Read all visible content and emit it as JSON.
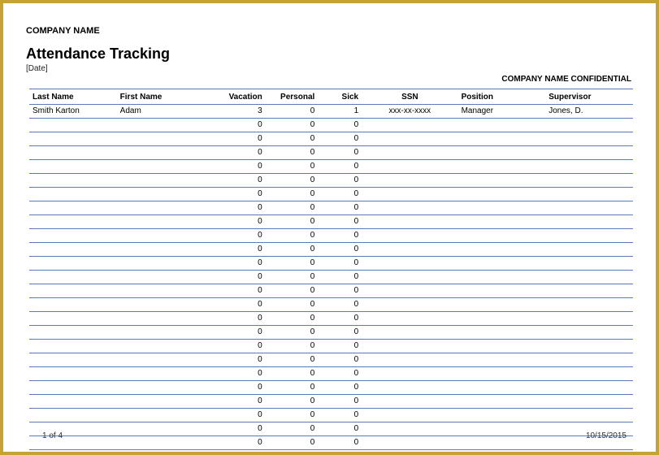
{
  "header": {
    "company_name": "COMPANY NAME",
    "title": "Attendance Tracking",
    "date_label": "[Date]",
    "confidential": "COMPANY NAME CONFIDENTIAL"
  },
  "columns": {
    "last_name": "Last Name",
    "first_name": "First Name",
    "vacation": "Vacation",
    "personal": "Personal",
    "sick": "Sick",
    "ssn": "SSN",
    "position": "Position",
    "supervisor": "Supervisor"
  },
  "rows": [
    {
      "last_name": "Smith Karton",
      "first_name": "Adam",
      "vacation": "3",
      "personal": "0",
      "sick": "1",
      "ssn": "xxx-xx-xxxx",
      "position": "Manager",
      "supervisor": "Jones, D."
    },
    {
      "last_name": "",
      "first_name": "",
      "vacation": "0",
      "personal": "0",
      "sick": "0",
      "ssn": "",
      "position": "",
      "supervisor": ""
    },
    {
      "last_name": "",
      "first_name": "",
      "vacation": "0",
      "personal": "0",
      "sick": "0",
      "ssn": "",
      "position": "",
      "supervisor": ""
    },
    {
      "last_name": "",
      "first_name": "",
      "vacation": "0",
      "personal": "0",
      "sick": "0",
      "ssn": "",
      "position": "",
      "supervisor": ""
    },
    {
      "last_name": "",
      "first_name": "",
      "vacation": "0",
      "personal": "0",
      "sick": "0",
      "ssn": "",
      "position": "",
      "supervisor": ""
    },
    {
      "last_name": "",
      "first_name": "",
      "vacation": "0",
      "personal": "0",
      "sick": "0",
      "ssn": "",
      "position": "",
      "supervisor": ""
    },
    {
      "last_name": "",
      "first_name": "",
      "vacation": "0",
      "personal": "0",
      "sick": "0",
      "ssn": "",
      "position": "",
      "supervisor": ""
    },
    {
      "last_name": "",
      "first_name": "",
      "vacation": "0",
      "personal": "0",
      "sick": "0",
      "ssn": "",
      "position": "",
      "supervisor": ""
    },
    {
      "last_name": "",
      "first_name": "",
      "vacation": "0",
      "personal": "0",
      "sick": "0",
      "ssn": "",
      "position": "",
      "supervisor": ""
    },
    {
      "last_name": "",
      "first_name": "",
      "vacation": "0",
      "personal": "0",
      "sick": "0",
      "ssn": "",
      "position": "",
      "supervisor": ""
    },
    {
      "last_name": "",
      "first_name": "",
      "vacation": "0",
      "personal": "0",
      "sick": "0",
      "ssn": "",
      "position": "",
      "supervisor": ""
    },
    {
      "last_name": "",
      "first_name": "",
      "vacation": "0",
      "personal": "0",
      "sick": "0",
      "ssn": "",
      "position": "",
      "supervisor": ""
    },
    {
      "last_name": "",
      "first_name": "",
      "vacation": "0",
      "personal": "0",
      "sick": "0",
      "ssn": "",
      "position": "",
      "supervisor": ""
    },
    {
      "last_name": "",
      "first_name": "",
      "vacation": "0",
      "personal": "0",
      "sick": "0",
      "ssn": "",
      "position": "",
      "supervisor": ""
    },
    {
      "last_name": "",
      "first_name": "",
      "vacation": "0",
      "personal": "0",
      "sick": "0",
      "ssn": "",
      "position": "",
      "supervisor": ""
    },
    {
      "last_name": "",
      "first_name": "",
      "vacation": "0",
      "personal": "0",
      "sick": "0",
      "ssn": "",
      "position": "",
      "supervisor": ""
    },
    {
      "last_name": "",
      "first_name": "",
      "vacation": "0",
      "personal": "0",
      "sick": "0",
      "ssn": "",
      "position": "",
      "supervisor": ""
    },
    {
      "last_name": "",
      "first_name": "",
      "vacation": "0",
      "personal": "0",
      "sick": "0",
      "ssn": "",
      "position": "",
      "supervisor": ""
    },
    {
      "last_name": "",
      "first_name": "",
      "vacation": "0",
      "personal": "0",
      "sick": "0",
      "ssn": "",
      "position": "",
      "supervisor": ""
    },
    {
      "last_name": "",
      "first_name": "",
      "vacation": "0",
      "personal": "0",
      "sick": "0",
      "ssn": "",
      "position": "",
      "supervisor": ""
    },
    {
      "last_name": "",
      "first_name": "",
      "vacation": "0",
      "personal": "0",
      "sick": "0",
      "ssn": "",
      "position": "",
      "supervisor": ""
    },
    {
      "last_name": "",
      "first_name": "",
      "vacation": "0",
      "personal": "0",
      "sick": "0",
      "ssn": "",
      "position": "",
      "supervisor": ""
    },
    {
      "last_name": "",
      "first_name": "",
      "vacation": "0",
      "personal": "0",
      "sick": "0",
      "ssn": "",
      "position": "",
      "supervisor": ""
    },
    {
      "last_name": "",
      "first_name": "",
      "vacation": "0",
      "personal": "0",
      "sick": "0",
      "ssn": "",
      "position": "",
      "supervisor": ""
    },
    {
      "last_name": "",
      "first_name": "",
      "vacation": "0",
      "personal": "0",
      "sick": "0",
      "ssn": "",
      "position": "",
      "supervisor": ""
    }
  ],
  "footer": {
    "page": "1 of 4",
    "date": "10/15/2015"
  }
}
